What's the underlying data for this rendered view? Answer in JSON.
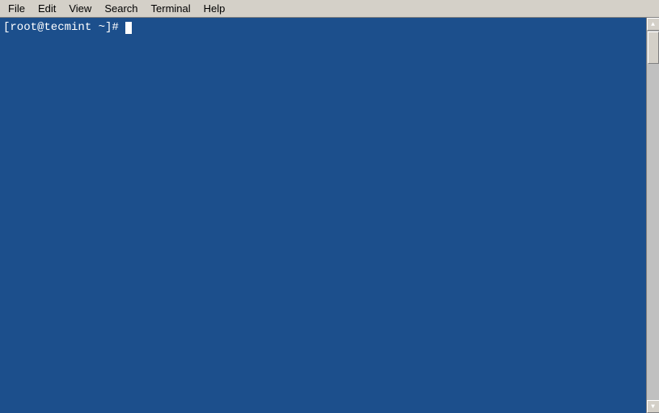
{
  "menubar": {
    "items": [
      {
        "id": "file",
        "label": "File"
      },
      {
        "id": "edit",
        "label": "Edit"
      },
      {
        "id": "view",
        "label": "View"
      },
      {
        "id": "search",
        "label": "Search"
      },
      {
        "id": "terminal",
        "label": "Terminal"
      },
      {
        "id": "help",
        "label": "Help"
      }
    ]
  },
  "terminal": {
    "prompt": "[root@tecmint ~]# "
  }
}
